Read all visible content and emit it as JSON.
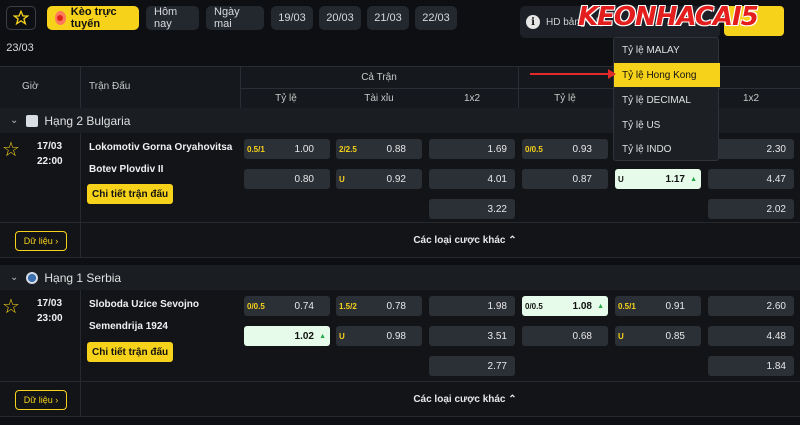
{
  "toolbar": {
    "live_label": "Kèo trực tuyến",
    "chips": [
      "Hôm nay",
      "Ngày mai",
      "19/03",
      "20/03",
      "21/03",
      "22/03",
      "23/03"
    ],
    "hd_label": "HD bảng tỉ lệ",
    "logo_text": "KEONHACAI",
    "logo_number": "5"
  },
  "dropdown": {
    "items": [
      "Tỷ lệ MALAY",
      "Tỷ lệ Hong Kong",
      "Tỷ lệ DECIMAL",
      "Tỷ lệ US",
      "Tỷ lệ INDO"
    ],
    "selected": "Tỷ lệ Hong Kong",
    "partial_top": "Tỷ lệ Hong Kong"
  },
  "header": {
    "gio": "Giờ",
    "tran_dau": "Trận Đấu",
    "ca_tran": "Cả Trận",
    "cols": [
      "Tỷ lệ",
      "Tài xỉu",
      "1x2",
      "Tỷ lệ",
      "1x2"
    ]
  },
  "leagues": [
    {
      "name": "Hạng 2 Bulgaria",
      "date": "17/03",
      "time": "22:00",
      "home": "Lokomotiv Gorna Oryahovitsa",
      "away": "Botev Plovdiv II",
      "detail": "Chi tiết trận đấu",
      "data": "Dữ liệu",
      "more": "Các loại cược khác",
      "odds": {
        "hdp_line": "0.5/1",
        "hdp_home": "1.00",
        "hdp_away": "0.80",
        "ou_line": "2/2.5",
        "ou_over": "0.88",
        "ou_u": "U",
        "ou_under": "0.92",
        "x12": [
          "1.69",
          "4.01",
          "3.22"
        ],
        "h1_line": "0/0.5",
        "h1_home": "0.93",
        "h1_away": "0.87",
        "h1_ou_u": "U",
        "h1_ou_under": "1.17",
        "h1_x12": [
          "2.30",
          "4.47",
          "2.02"
        ]
      }
    },
    {
      "name": "Hạng 1 Serbia",
      "date": "17/03",
      "time": "23:00",
      "home": "Sloboda Uzice Sevojno",
      "away": "Semendrija 1924",
      "detail": "Chi tiết trận đấu",
      "data": "Dữ liệu",
      "more": "Các loại cược khác",
      "odds": {
        "hdp_line": "0/0.5",
        "hdp_home": "0.74",
        "hdp_away": "1.02",
        "ou_line": "1.5/2",
        "ou_over": "0.78",
        "ou_u": "U",
        "ou_under": "0.98",
        "x12": [
          "1.98",
          "3.51",
          "2.77"
        ],
        "h1_line": "0/0.5",
        "h1_home": "1.08",
        "h1_away": "0.68",
        "h1_ou_line": "0.5/1",
        "h1_ou_over": "0.91",
        "h1_ou_u": "U",
        "h1_ou_under": "0.85",
        "h1_x12": [
          "2.60",
          "4.48",
          "1.84"
        ]
      }
    }
  ],
  "colors": {
    "accent": "#f7d21a",
    "highlight": "#e6fbe9",
    "arrow": "#e22a2a"
  }
}
